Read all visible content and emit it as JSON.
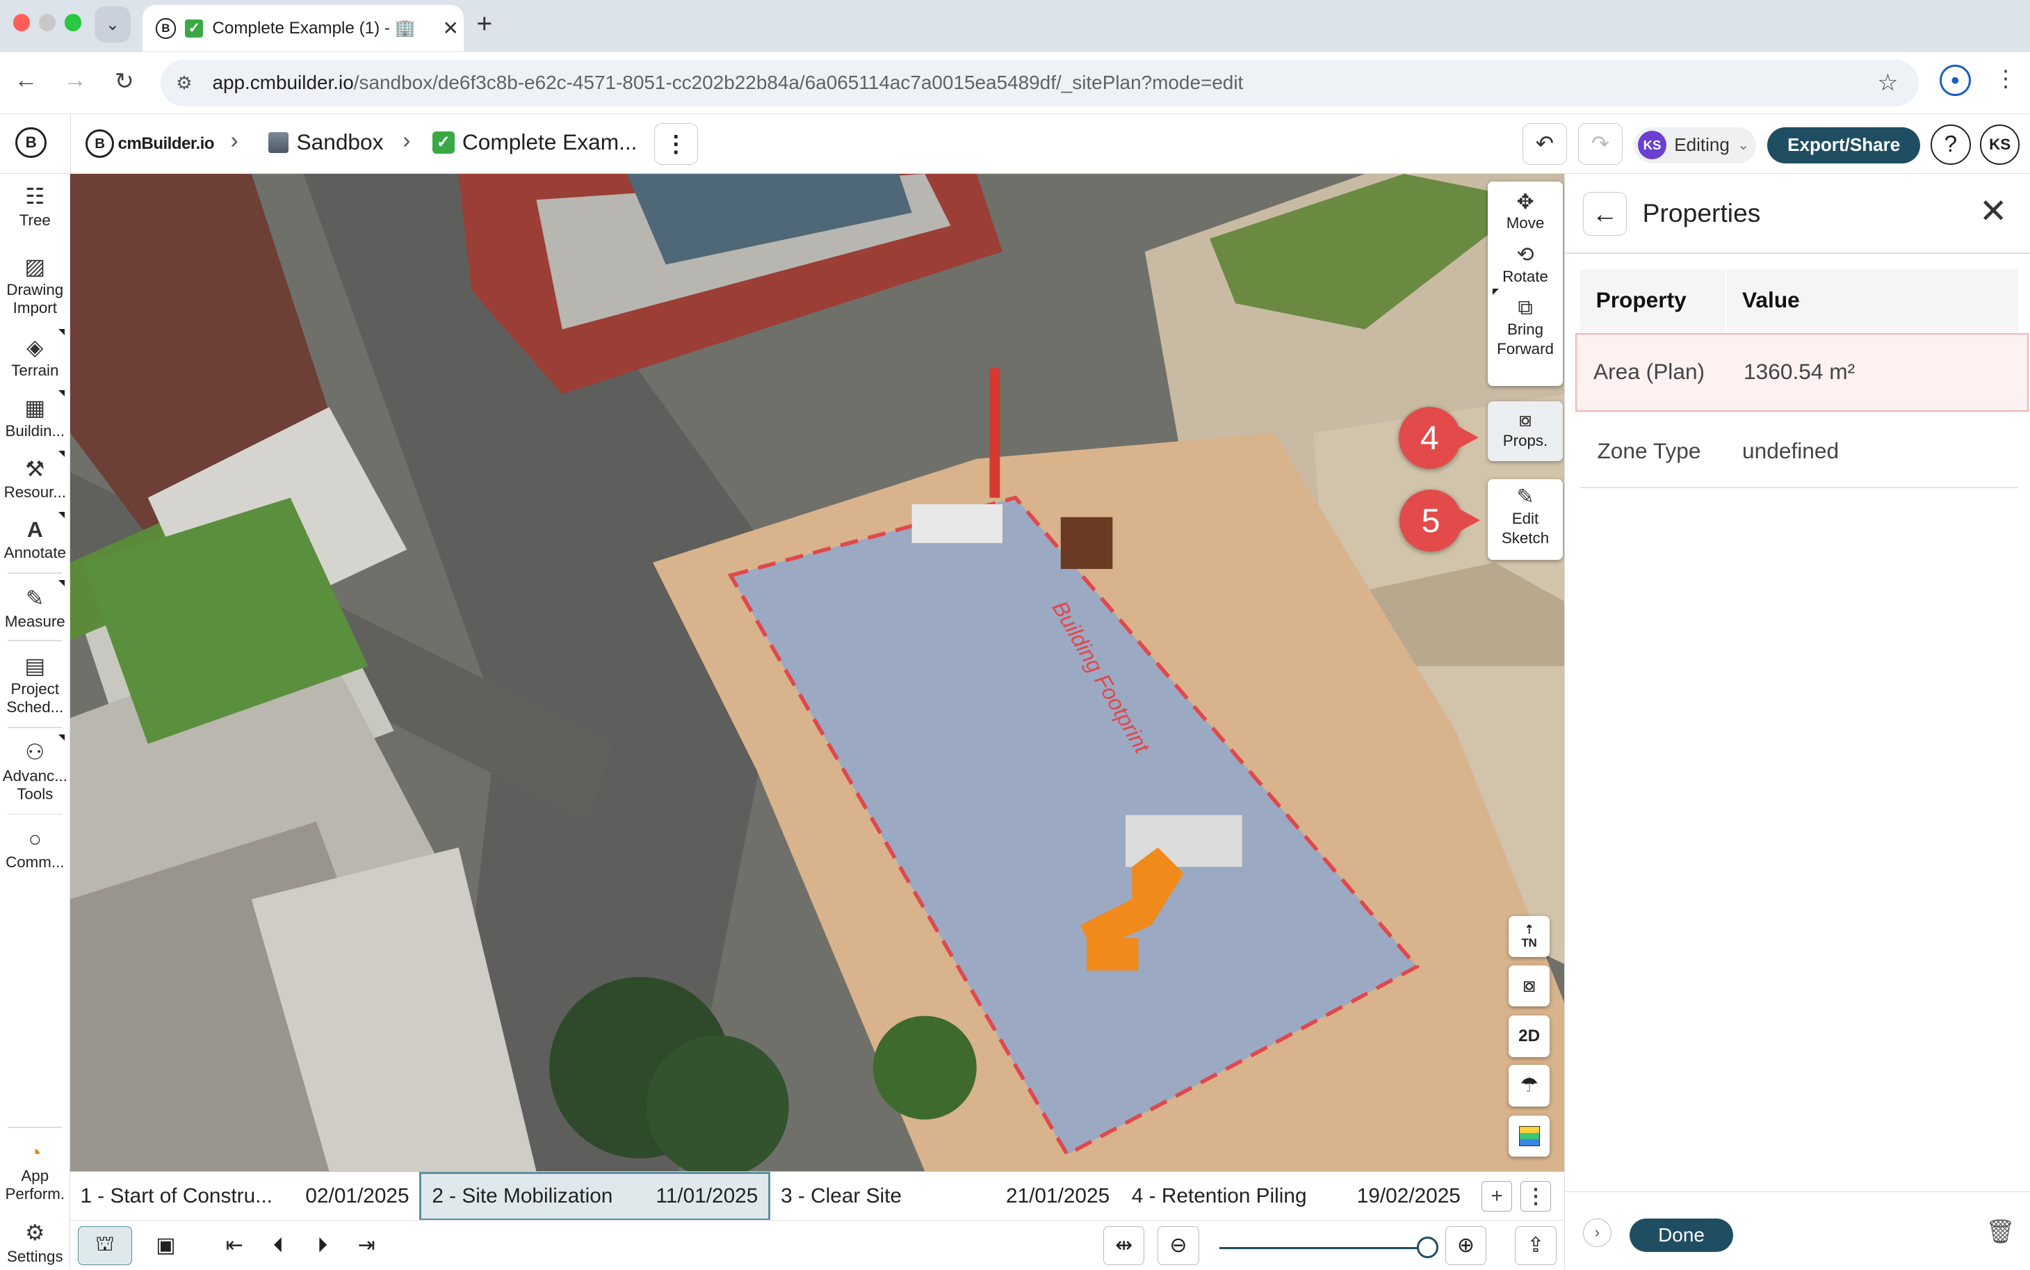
{
  "browser": {
    "tab_title": "Complete Example (1) - 🏢",
    "tab_close": "✕",
    "new_tab": "+",
    "url_host": "app.cmbuilder.io",
    "url_path": "/sandbox/de6f3c8b-e62c-4571-8051-cc202b22b84a/6a065114ac7a0015ea5489df/_sitePlan?mode=edit"
  },
  "header": {
    "brand": "cmBuilder.io",
    "breadcrumb": [
      "Sandbox",
      "Complete Exam..."
    ],
    "mode_avatar": "KS",
    "mode_label": "Editing",
    "export_label": "Export/Share",
    "help_label": "?",
    "user_initials": "KS"
  },
  "left_toolbar": [
    {
      "label": "Tree",
      "icon": "tree-icon"
    },
    {
      "label": "Drawing Import",
      "icon": "drawing-import-icon"
    },
    {
      "label": "Terrain",
      "icon": "terrain-icon"
    },
    {
      "label": "Buildin...",
      "icon": "building-icon"
    },
    {
      "label": "Resour...",
      "icon": "resources-icon"
    },
    {
      "label": "Annotate",
      "icon": "annotate-icon"
    },
    {
      "label": "Measure",
      "icon": "measure-icon"
    },
    {
      "label": "Project Sched...",
      "icon": "schedule-icon"
    },
    {
      "label": "Advanc... Tools",
      "icon": "advanced-tools-icon"
    },
    {
      "label": "Comm...",
      "icon": "comment-icon"
    },
    {
      "label": "App Perform.",
      "icon": "performance-icon"
    },
    {
      "label": "Settings",
      "icon": "settings-icon"
    }
  ],
  "right_tools": {
    "move": "Move",
    "rotate": "Rotate",
    "bring_forward": "Bring Forward",
    "props": "Props.",
    "edit_sketch": "Edit Sketch"
  },
  "markers": {
    "props": "4",
    "edit_sketch": "5"
  },
  "view_controls": {
    "north": "TN",
    "dim": "2D"
  },
  "scene": {
    "footprint_label": "Building Footprint"
  },
  "timeline": [
    {
      "name": "1 - Start of Constru...",
      "date": "02/01/2025",
      "active": false
    },
    {
      "name": "2 - Site Mobilization",
      "date": "11/01/2025",
      "active": true
    },
    {
      "name": "3 - Clear Site",
      "date": "21/01/2025",
      "active": false
    },
    {
      "name": "4 - Retention Piling",
      "date": "19/02/2025",
      "active": false
    }
  ],
  "properties": {
    "title": "Properties",
    "col_property": "Property",
    "col_value": "Value",
    "rows": [
      {
        "key": "Area (Plan)",
        "value": "1360.54 m²"
      },
      {
        "key": "Zone Type",
        "value": "undefined"
      }
    ],
    "done_label": "Done"
  },
  "colors": {
    "accent": "#1f4e63",
    "marker": "#e34b4b",
    "footprint": "#e0484c"
  }
}
